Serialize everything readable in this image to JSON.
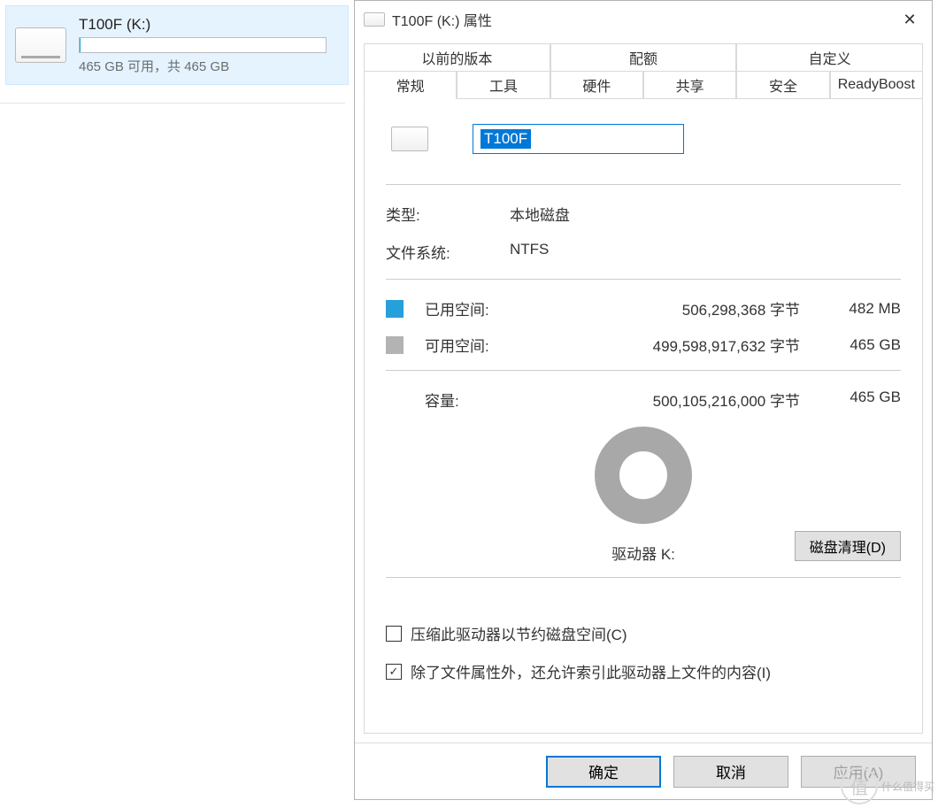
{
  "drive_tile": {
    "title": "T100F (K:)",
    "subtitle": "465 GB 可用，共 465 GB"
  },
  "dialog": {
    "title": "T100F (K:) 属性",
    "tabs_row1": [
      "以前的版本",
      "配额",
      "自定义"
    ],
    "tabs_row2": [
      "常规",
      "工具",
      "硬件",
      "共享",
      "安全",
      "ReadyBoost"
    ],
    "active_tab": "常规",
    "name_value": "T100F",
    "type_label": "类型:",
    "type_value": "本地磁盘",
    "fs_label": "文件系统:",
    "fs_value": "NTFS",
    "used_label": "已用空间:",
    "used_bytes": "506,298,368 字节",
    "used_size": "482 MB",
    "free_label": "可用空间:",
    "free_bytes": "499,598,917,632 字节",
    "free_size": "465 GB",
    "cap_label": "容量:",
    "cap_bytes": "500,105,216,000 字节",
    "cap_size": "465 GB",
    "pie_label": "驱动器 K:",
    "cleanup_button": "磁盘清理(D)",
    "compress_checkbox": "压缩此驱动器以节约磁盘空间(C)",
    "index_checkbox": "除了文件属性外，还允许索引此驱动器上文件的内容(I)",
    "compress_checked": false,
    "index_checked": true,
    "buttons": {
      "ok": "确定",
      "cancel": "取消",
      "apply": "应用(A)"
    }
  },
  "watermark": {
    "circle": "值",
    "text": "什么值得买"
  },
  "colors": {
    "used": "#26a0da",
    "free": "#b3b3b3",
    "accent": "#0078d7"
  }
}
